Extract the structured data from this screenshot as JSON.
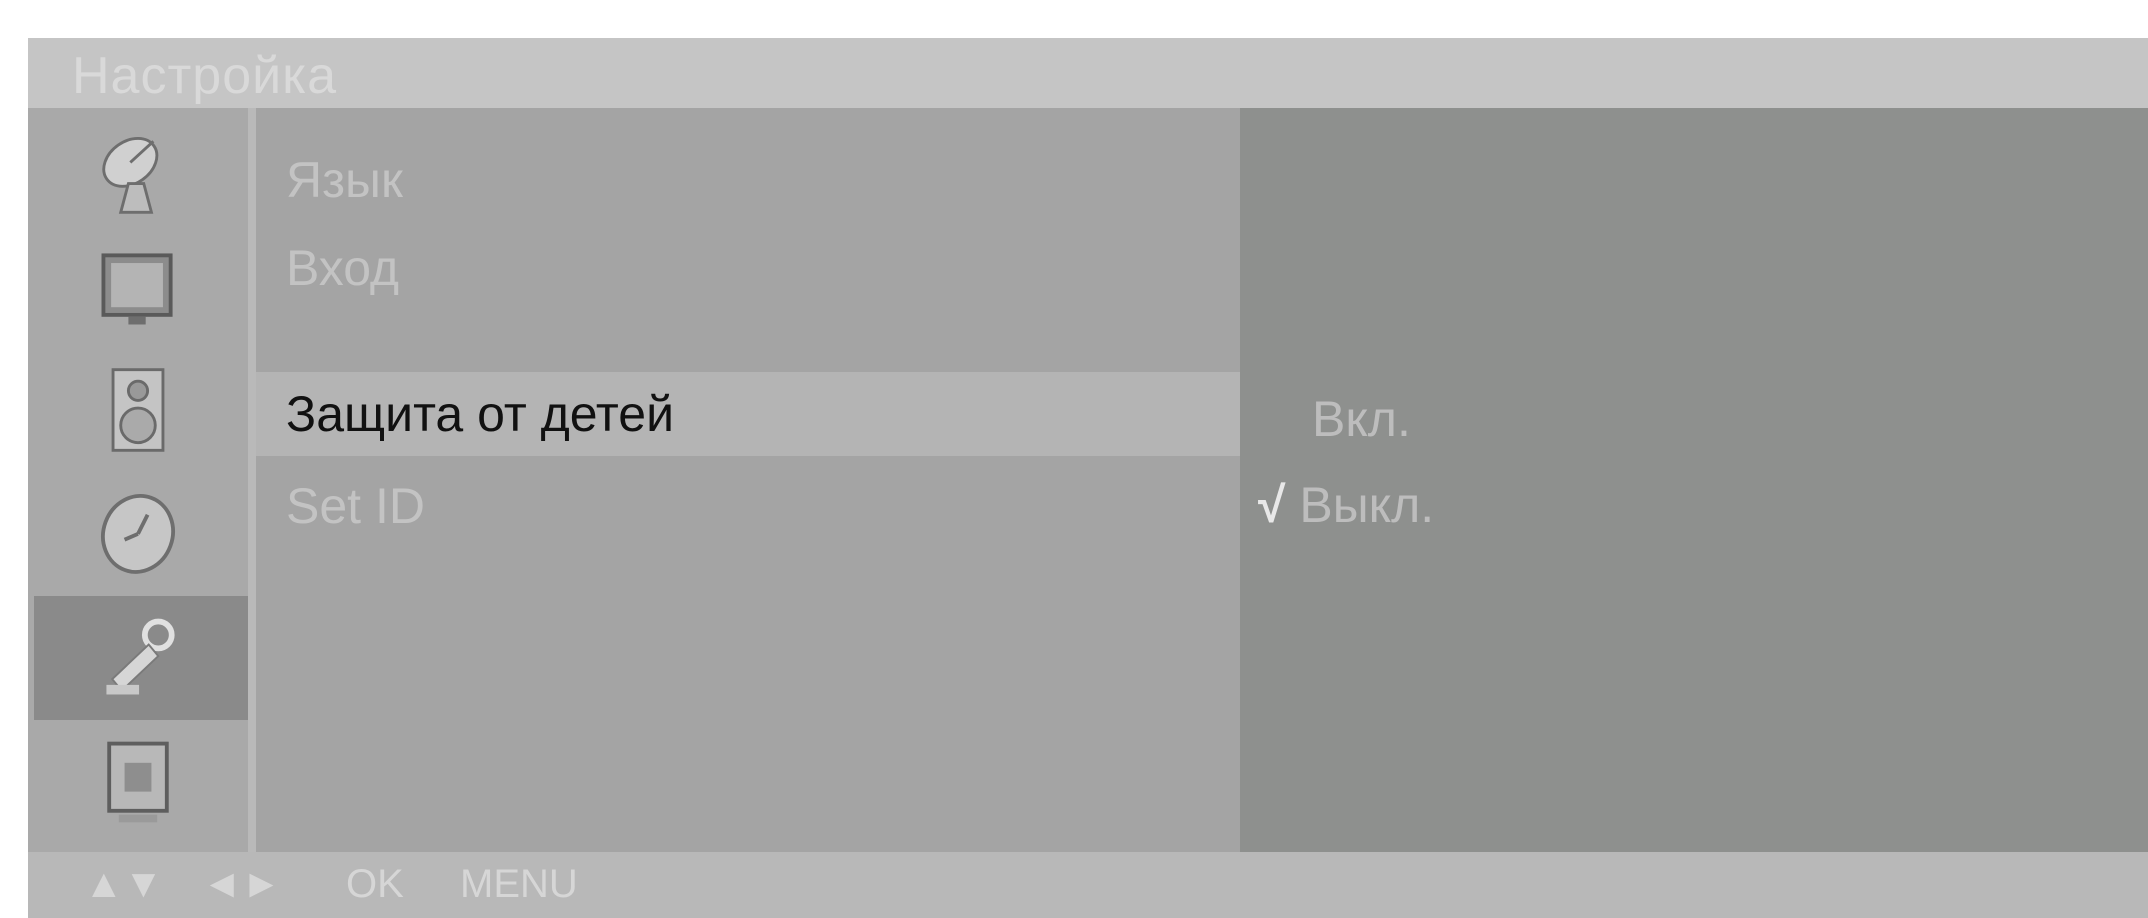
{
  "title": "Настройка",
  "sidebar": {
    "items": [
      {
        "icon": "satellite-dish-icon"
      },
      {
        "icon": "tv-picture-icon"
      },
      {
        "icon": "speaker-icon"
      },
      {
        "icon": "clock-icon"
      },
      {
        "icon": "wrench-icon",
        "active": true
      },
      {
        "icon": "screen-icon"
      }
    ]
  },
  "menu": {
    "items": [
      {
        "label": "Язык"
      },
      {
        "label": "Вход"
      },
      {
        "label": "Защита от детей",
        "selected": true
      },
      {
        "label": "Set ID"
      }
    ]
  },
  "options": [
    {
      "label": "Вкл.",
      "checked": false
    },
    {
      "label": "Выкл.",
      "checked": true
    }
  ],
  "check_mark": "√",
  "footer": {
    "nav_updown": "▲▼",
    "nav_leftright": "◄►",
    "ok": "OK",
    "menu": "MENU"
  },
  "colors": {
    "selected_bg": "#b4b4b4",
    "selected_text": "#111111",
    "panel_right": "#8e908e",
    "active_sidebar": "#8a8a8a"
  }
}
